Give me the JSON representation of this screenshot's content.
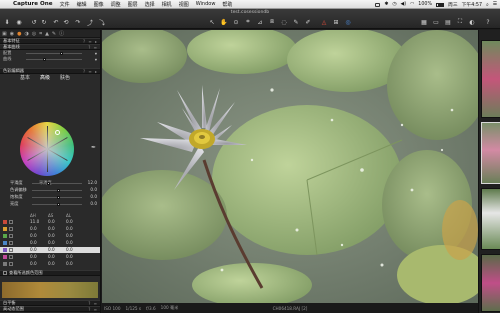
{
  "menubar": {
    "app_name": "Capture One",
    "items": [
      "文件",
      "编辑",
      "图像",
      "调整",
      "图层",
      "选择",
      "相机",
      "视图",
      "Window",
      "帮助"
    ],
    "status": {
      "battery": "100%",
      "day": "周三",
      "time": "下午4:57"
    }
  },
  "toolbar": {
    "document_title": "test.cosessiondb",
    "icons": [
      "inbox-icon",
      "camera-icon",
      "rotate-icon",
      "undo-icon",
      "redo-icon",
      "compare-icon",
      "pointer-icon",
      "pan-icon",
      "zoom-icon",
      "crop-icon",
      "straighten-icon",
      "keystone-icon",
      "spot-icon",
      "picker-icon",
      "annotate-icon",
      "warning-icon",
      "grid-icon",
      "layout-icon"
    ]
  },
  "left_panel": {
    "tool_tabs": [
      "folder-icon",
      "camera-icon",
      "color-icon",
      "exposure-icon",
      "lens-icon",
      "crop-icon",
      "detail-icon",
      "adjust-icon",
      "meta-icon"
    ],
    "section1": {
      "title": "基本特征",
      "sub_title": "基本曲线",
      "rows": [
        {
          "label": "配置",
          "value": "",
          "thumb": 0.5
        },
        {
          "label": "曲线",
          "value": "",
          "thumb": 0.6
        }
      ]
    },
    "section2": {
      "title": "色彩编辑器",
      "tabs": [
        "基本",
        "高级",
        "肤色"
      ]
    },
    "adjust_rows": [
      {
        "label": "平滑度",
        "value": "12.0",
        "thumb": 0.3
      },
      {
        "label": "色调偏移",
        "value": "0.0",
        "thumb": 0.5
      },
      {
        "label": "饱和度",
        "value": "0.0",
        "thumb": 0.5
      },
      {
        "label": "亮度",
        "value": "0.0",
        "thumb": 0.5
      }
    ],
    "table": {
      "headers": [
        "ΔH",
        "ΔS",
        "ΔL"
      ],
      "rows": [
        {
          "color": "#c84a3a",
          "values": [
            "11.0",
            "0.0",
            "0.0"
          ],
          "selected": false
        },
        {
          "color": "#d9a030",
          "values": [
            "0.0",
            "0.0",
            "0.0"
          ],
          "selected": false
        },
        {
          "color": "#5aa84a",
          "values": [
            "0.0",
            "0.0",
            "0.0"
          ],
          "selected": false
        },
        {
          "color": "#4a86c8",
          "values": [
            "0.0",
            "0.0",
            "0.0"
          ],
          "selected": false
        },
        {
          "color": "#7a55c0",
          "values": [
            "0.0",
            "0.0",
            "0.0"
          ],
          "selected": true
        },
        {
          "color": "#c04a9a",
          "values": [
            "0.0",
            "0.0",
            "0.0"
          ],
          "selected": false
        },
        {
          "color": "#7a7a7a",
          "values": [
            "0.0",
            "0.0",
            "0.0"
          ],
          "selected": false
        }
      ]
    },
    "skin_section": "查看所选颜色范围",
    "bottom_sections": [
      "白平衡",
      "高动态范围",
      "色彩平衡"
    ]
  },
  "viewer": {
    "status_meta": [
      "ISO 100",
      "1/125 s",
      "f/3.6",
      "100 毫米"
    ],
    "file_name": "CH06418.RAJ [2]"
  }
}
